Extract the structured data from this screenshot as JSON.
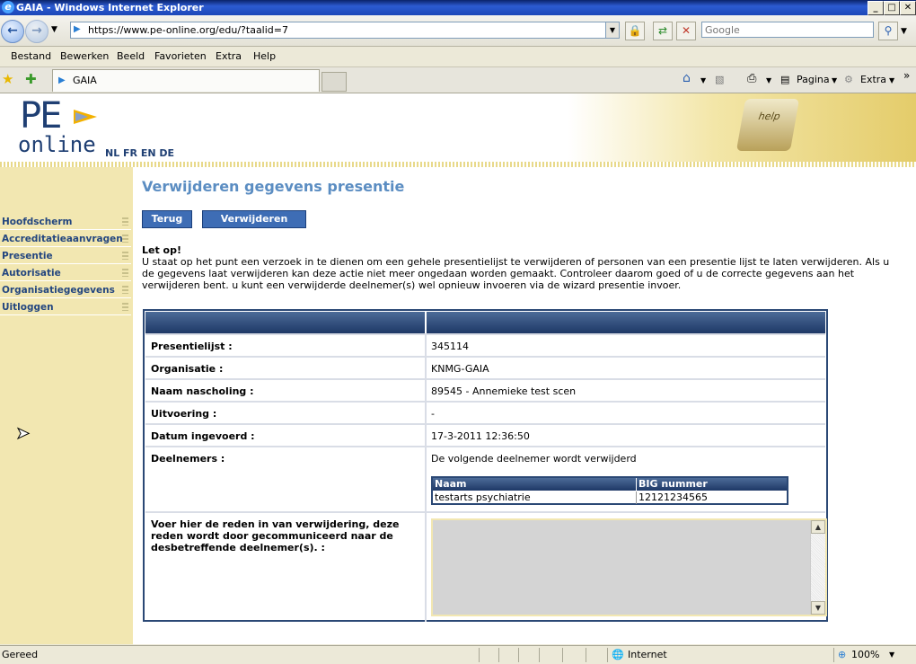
{
  "window": {
    "title": "GAIA - Windows Internet Explorer",
    "min": "_",
    "max": "□",
    "close": "✕"
  },
  "address": {
    "url": "https://www.pe-online.org/edu/?taalid=7",
    "search_placeholder": "Google"
  },
  "menu": [
    "Bestand",
    "Bewerken",
    "Beeld",
    "Favorieten",
    "Extra",
    "Help"
  ],
  "tab": {
    "label": "GAIA"
  },
  "toolbar": {
    "pagina": "Pagina",
    "extra": "Extra"
  },
  "site": {
    "logo_top": "PE",
    "logo_bottom": "online",
    "languages": "NL FR EN DE",
    "help_key": "help"
  },
  "sidebar": {
    "items": [
      {
        "label": "Hoofdscherm"
      },
      {
        "label": "Accreditatieaanvragen"
      },
      {
        "label": "Presentie"
      },
      {
        "label": "Autorisatie"
      },
      {
        "label": "Organisatiegegevens"
      },
      {
        "label": "Uitloggen"
      }
    ]
  },
  "page": {
    "title": "Verwijderen gegevens presentie",
    "back_button": "Terug",
    "delete_button": "Verwijderen",
    "notice_heading": "Let op!",
    "notice_text": "U staat op het punt een verzoek in te dienen om een gehele presentielijst te verwijderen of personen van een presentie lijst te laten verwijderen. Als u de gegevens laat verwijderen kan deze actie niet meer ongedaan worden gemaakt. Controleer daarom goed of u de correcte gegevens aan het verwijderen bent. u kunt een verwijderde deelnemer(s) wel opnieuw invoeren via de wizard presentie invoer."
  },
  "details": {
    "rows": [
      {
        "label": "Presentielijst :",
        "value": "345114"
      },
      {
        "label": "Organisatie :",
        "value": "KNMG-GAIA"
      },
      {
        "label": "Naam nascholing :",
        "value": "89545 - Annemieke test scen"
      },
      {
        "label": "Uitvoering :",
        "value": "-"
      },
      {
        "label": "Datum ingevoerd :",
        "value": "17-3-2011 12:36:50"
      }
    ],
    "participants": {
      "label": "Deelnemers :",
      "intro": "De volgende deelnemer wordt verwijderd",
      "headers": [
        "Naam",
        "BIG nummer"
      ],
      "rows": [
        [
          "testarts psychiatrie",
          "12121234565"
        ]
      ]
    },
    "reason": {
      "label": "Voer hier de reden in van verwijdering, deze reden wordt door gecommuniceerd naar de desbetreffende deelnemer(s). :",
      "value": ""
    }
  },
  "statusbar": {
    "left": "Gereed",
    "zone": "Internet",
    "zoom": "100%"
  }
}
